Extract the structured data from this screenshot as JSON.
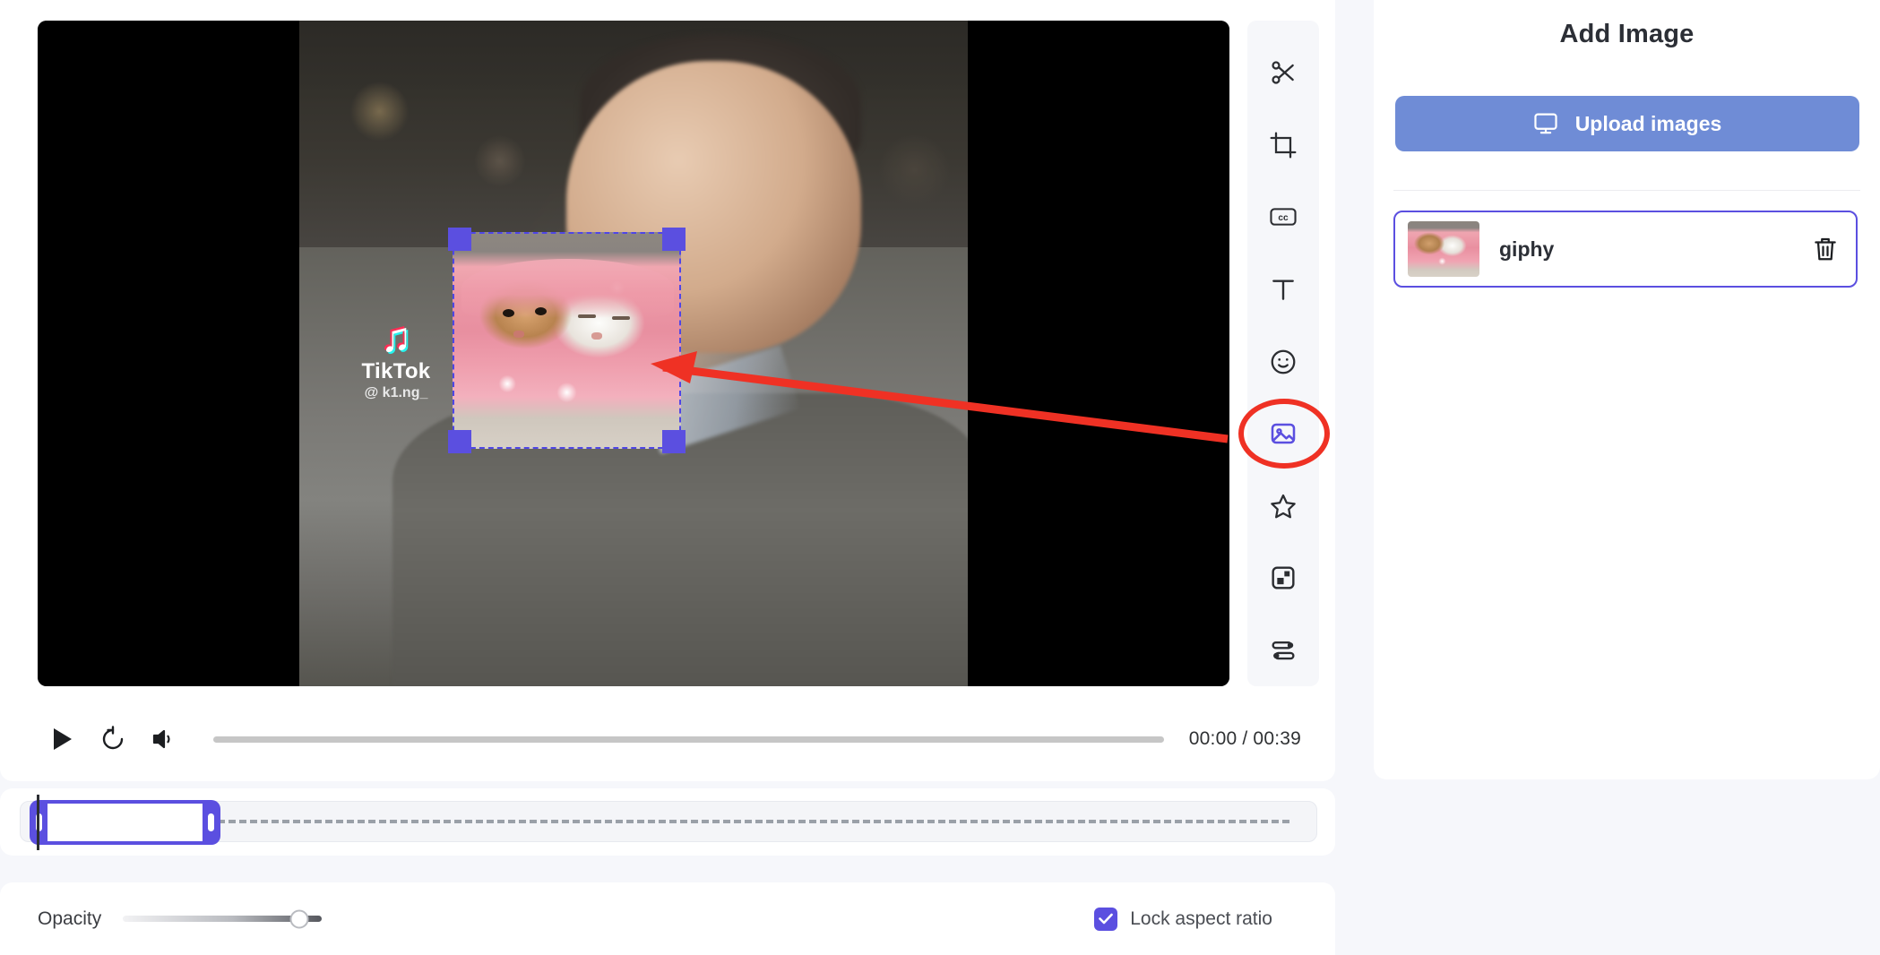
{
  "app": {
    "background_color": "#f6f7fb",
    "accent_color": "#5b4fe0",
    "annotation_color": "#ef3124"
  },
  "preview": {
    "watermark": {
      "icon": "tiktok-note-icon",
      "brand": "TikTok",
      "handle": "@ k1.ng_"
    },
    "selected_overlay": {
      "name": "giphy",
      "handles": 4,
      "selected": true
    }
  },
  "player": {
    "play_icon": "play-icon",
    "restart_icon": "restart-icon",
    "volume_icon": "volume-icon",
    "progress_percent": 0,
    "time_display": "00:00 / 00:39",
    "current_time": "00:00",
    "duration": "00:39"
  },
  "toolbar": {
    "items": [
      {
        "name": "split-icon",
        "label": "Split"
      },
      {
        "name": "crop-icon",
        "label": "Crop"
      },
      {
        "name": "captions-icon",
        "label": "CC"
      },
      {
        "name": "text-icon",
        "label": "Text"
      },
      {
        "name": "emoji-icon",
        "label": "Emoji"
      },
      {
        "name": "image-icon",
        "label": "Image",
        "active": true,
        "highlighted": true
      },
      {
        "name": "star-icon",
        "label": "Effects"
      },
      {
        "name": "overlay-icon",
        "label": "Overlay"
      },
      {
        "name": "settings-icon",
        "label": "Settings"
      }
    ]
  },
  "timeline": {
    "clip_selected": true,
    "playhead_position_percent": 1
  },
  "properties": {
    "opacity_label": "Opacity",
    "opacity_percent": 88,
    "lock_aspect_ratio_label": "Lock aspect ratio",
    "lock_aspect_ratio_checked": true,
    "check_icon": "check-icon"
  },
  "right_panel": {
    "title": "Add Image",
    "upload_button": {
      "label": "Upload images",
      "icon": "monitor-icon"
    },
    "images": [
      {
        "name": "giphy",
        "thumbnail": "cats-in-pink-blanket-thumbnail",
        "delete_icon": "trash-icon",
        "selected": true
      }
    ]
  }
}
